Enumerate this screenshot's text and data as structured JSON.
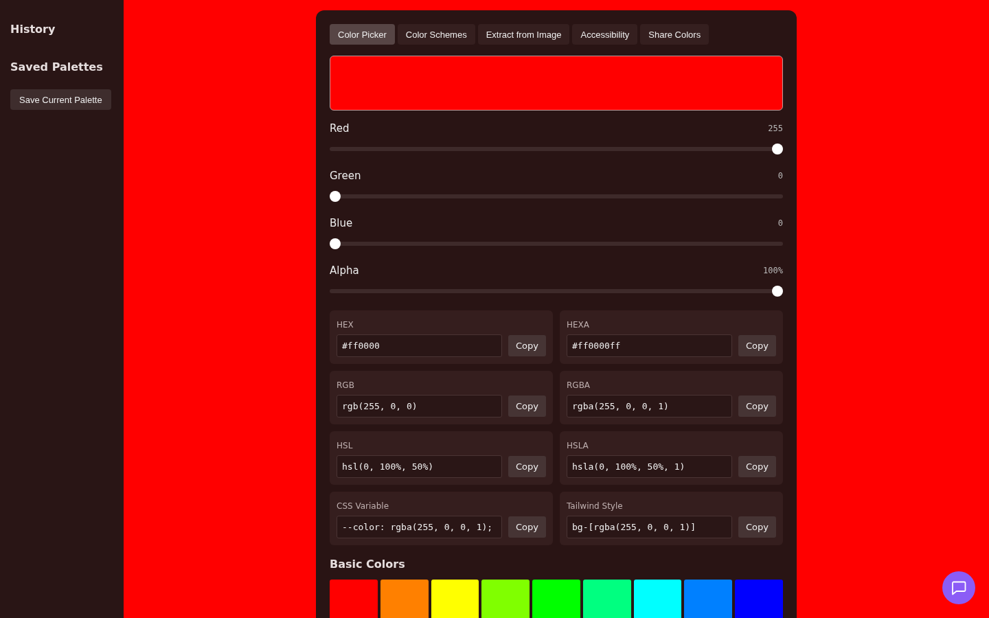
{
  "sidebar": {
    "history_title": "History",
    "saved_palettes_title": "Saved Palettes",
    "save_button": "Save Current Palette"
  },
  "tabs": [
    {
      "label": "Color Picker",
      "selected": true
    },
    {
      "label": "Color Schemes",
      "selected": false
    },
    {
      "label": "Extract from Image",
      "selected": false
    },
    {
      "label": "Accessibility",
      "selected": false
    },
    {
      "label": "Share Colors",
      "selected": false
    }
  ],
  "sliders": [
    {
      "label": "Red",
      "reading": "255",
      "level": 1
    },
    {
      "label": "Green",
      "reading": "0",
      "level": 0
    },
    {
      "label": "Blue",
      "reading": "0",
      "level": 0
    },
    {
      "label": "Alpha",
      "reading": "100%",
      "level": 1
    }
  ],
  "formats": [
    {
      "label": "HEX",
      "value": "#ff0000",
      "button": "Copy"
    },
    {
      "label": "HEXA",
      "value": "#ff0000ff",
      "button": "Copy"
    },
    {
      "label": "RGB",
      "value": "rgb(255, 0, 0)",
      "button": "Copy"
    },
    {
      "label": "RGBA",
      "value": "rgba(255, 0, 0, 1)",
      "button": "Copy"
    },
    {
      "label": "HSL",
      "value": "hsl(0, 100%, 50%)",
      "button": "Copy"
    },
    {
      "label": "HSLA",
      "value": "hsla(0, 100%, 50%, 1)",
      "button": "Copy"
    },
    {
      "label": "CSS Variable",
      "value": "--color: rgba(255, 0, 0, 1);",
      "button": "Copy"
    },
    {
      "label": "Tailwind Style",
      "value": "bg-[rgba(255, 0, 0, 1)]",
      "button": "Copy"
    }
  ],
  "basic_colors": {
    "title": "Basic Colors",
    "swatches": [
      {
        "color": "#ff0000"
      },
      {
        "color": "#ff8000"
      },
      {
        "color": "#ffff00"
      },
      {
        "color": "#80ff00"
      },
      {
        "color": "#00ff00"
      },
      {
        "color": "#00ff80"
      },
      {
        "color": "#00ffff"
      },
      {
        "color": "#0080ff"
      },
      {
        "color": "#0000ff"
      }
    ]
  }
}
